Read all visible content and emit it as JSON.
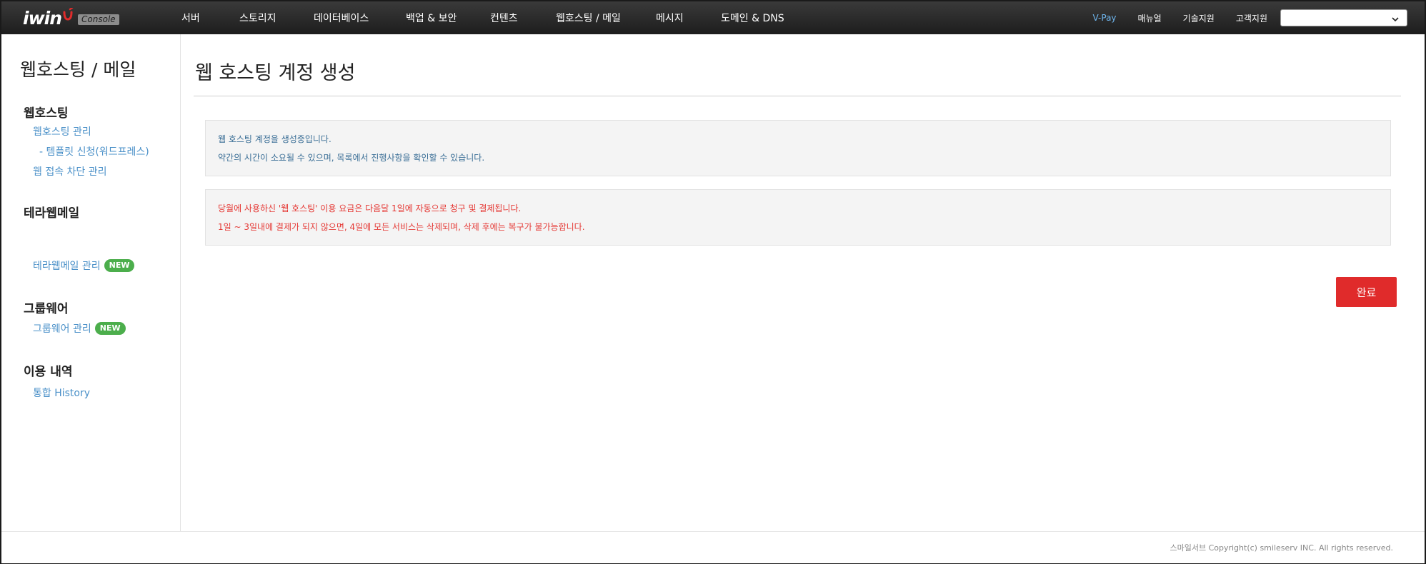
{
  "brand": {
    "logo_text": "iwin",
    "badge": "Console"
  },
  "topnav": {
    "items": [
      {
        "label": "서버"
      },
      {
        "label": "스토리지"
      },
      {
        "label": "데이터베이스"
      },
      {
        "label": "백업 & 보안"
      },
      {
        "label": "컨텐츠"
      },
      {
        "label": "웹호스팅 / 메일"
      },
      {
        "label": "메시지"
      },
      {
        "label": "도메인 & DNS"
      }
    ],
    "utils": {
      "vpay": "V-Pay",
      "manual": "매뉴얼",
      "tech_support": "기술지원",
      "customer_support": "고객지원"
    },
    "account_select_value": ""
  },
  "sidebar": {
    "title": "웹호스팅 / 메일",
    "sections": [
      {
        "title": "웹호스팅",
        "links": [
          {
            "label": "웹호스팅 관리"
          },
          {
            "label": "- 템플릿 신청(워드프레스)"
          },
          {
            "label": "웹 접속 차단 관리"
          }
        ]
      },
      {
        "title": "테라웹메일",
        "links": [
          {
            "label": "테라웹메일 관리",
            "badge": "NEW"
          }
        ]
      },
      {
        "title": "그룹웨어",
        "links": [
          {
            "label": "그룹웨어 관리",
            "badge": "NEW"
          }
        ]
      },
      {
        "title": "이용 내역",
        "links": [
          {
            "label": "통합 History"
          }
        ]
      }
    ]
  },
  "main": {
    "title": "웹 호스팅 계정 생성",
    "info_notice": {
      "line1": "웹 호스팅 계정을 생성중입니다.",
      "line2": "약간의 시간이 소요될 수 있으며, 목록에서 진행사항을 확인할 수 있습니다."
    },
    "warn_notice": {
      "line1": "당월에 사용하신 '웹 호스팅' 이용 요금은 다음달 1일에 자동으로 청구 및 결제됩니다.",
      "line2": "1일 ~ 3일내에 결제가 되지 않으면, 4일에 모든 서비스는 삭제되며, 삭제 후에는 복구가 불가능합니다."
    },
    "done_button": "완료"
  },
  "footer": {
    "copyright": "스마일서브 Copyright(c) smileserv INC. All rights reserved."
  },
  "colors": {
    "accent_red": "#e02b2b",
    "link_blue": "#4a90c8",
    "vpay_blue": "#6fb6ee",
    "badge_green": "#4cae4c",
    "warn_text": "#e53935"
  }
}
